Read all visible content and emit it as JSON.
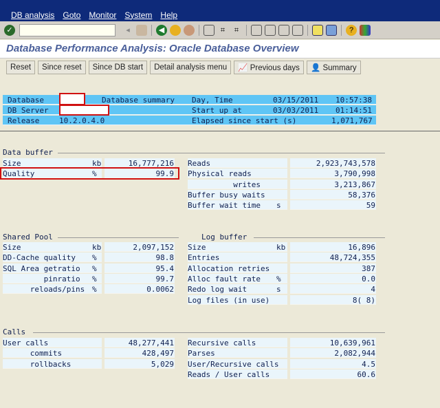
{
  "menu": [
    "DB analysis",
    "Goto",
    "Monitor",
    "System",
    "Help"
  ],
  "page_title": "Database Performance Analysis: Oracle Database Overview",
  "buttons": [
    "Reset",
    "Since reset",
    "Since DB start",
    "Detail analysis menu",
    "Previous days",
    "Summary"
  ],
  "header": {
    "database_label": "Database",
    "database_summary": "Database summary",
    "day_time_label": "Day, Time",
    "day": "03/15/2011",
    "time": "10:57:38",
    "server_label": "DB Server",
    "startup_label": "Start up at",
    "startup_date": "03/03/2011",
    "startup_time": "01:14:51",
    "release_label": "Release",
    "release": "10.2.0.4.0",
    "elapsed_label": "Elapsed since start (s)",
    "elapsed": "1,071,767"
  },
  "sections": {
    "data_buffer": "Data buffer",
    "shared_pool": "Shared Pool",
    "log_buffer": "Log buffer",
    "calls": "Calls"
  },
  "data_buffer_left": [
    [
      "Size",
      "kb",
      "16,777,216"
    ],
    [
      "Quality",
      "%",
      "99.9"
    ]
  ],
  "data_buffer_right": [
    [
      "Reads",
      "",
      "2,923,743,578"
    ],
    [
      "Physical reads",
      "",
      "3,790,998"
    ],
    [
      "          writes",
      "",
      "3,213,867"
    ],
    [
      "Buffer busy waits",
      "",
      "58,376"
    ],
    [
      "Buffer wait time",
      "s",
      "59"
    ]
  ],
  "shared_pool": [
    [
      "Size",
      "kb",
      "2,097,152"
    ],
    [
      "DD-Cache quality",
      "%",
      "98.8"
    ],
    [
      "SQL Area getratio",
      "%",
      "95.4"
    ],
    [
      "         pinratio",
      "%",
      "99.7"
    ],
    [
      "      reloads/pins",
      "%",
      "0.0062"
    ]
  ],
  "log_buffer": [
    [
      "Size",
      "kb",
      "16,896"
    ],
    [
      "Entries",
      "",
      "48,724,355"
    ],
    [
      "Allocation retries",
      "",
      "387"
    ],
    [
      "Alloc fault rate",
      "%",
      "0.0"
    ],
    [
      "Redo log wait",
      "s",
      "4"
    ],
    [
      "Log files (in use)",
      "",
      "8( 8)"
    ]
  ],
  "calls_left": [
    [
      "User calls",
      "",
      "48,277,441"
    ],
    [
      "      commits",
      "",
      "428,497"
    ],
    [
      "      rollbacks",
      "",
      "5,029"
    ]
  ],
  "calls_right": [
    [
      "Recursive calls",
      "",
      "10,639,961"
    ],
    [
      "Parses",
      "",
      "2,082,944"
    ],
    [
      "User/Recursive calls",
      "",
      "4.5"
    ],
    [
      "Reads / User calls",
      "",
      "60.6"
    ]
  ]
}
